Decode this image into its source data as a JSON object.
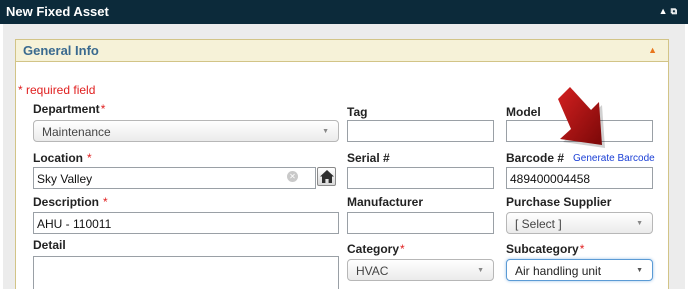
{
  "window": {
    "title": "New Fixed Asset",
    "icons": [
      "collapse-icon",
      "restore-icon"
    ]
  },
  "panel": {
    "title": "General Info"
  },
  "form": {
    "required_note": "* required field",
    "department": {
      "label": "Department",
      "value": "Maintenance",
      "required": true
    },
    "tag": {
      "label": "Tag",
      "value": ""
    },
    "model": {
      "label": "Model",
      "value": ""
    },
    "location": {
      "label": "Location",
      "value": "Sky Valley",
      "required": true
    },
    "serial": {
      "label": "Serial #",
      "value": ""
    },
    "barcode": {
      "label": "Barcode #",
      "value": "489400004458",
      "link": "Generate Barcode"
    },
    "description": {
      "label": "Description",
      "value": "AHU - 110011",
      "required": true
    },
    "manufacturer": {
      "label": "Manufacturer",
      "value": ""
    },
    "purchase_supplier": {
      "label": "Purchase Supplier",
      "value": "[ Select ]"
    },
    "detail": {
      "label": "Detail",
      "value": ""
    },
    "category": {
      "label": "Category",
      "value": "HVAC",
      "required": true
    },
    "subcategory": {
      "label": "Subcategory",
      "value": "Air handling unit",
      "required": true
    },
    "required_mark": "*"
  },
  "colors": {
    "titlebar": "#0c2a3a",
    "panel_header": "#f6f2d8",
    "panel_title": "#3a6a8f",
    "required": "#e02020",
    "link": "#1a3fd6",
    "arrow": "#b01010"
  }
}
